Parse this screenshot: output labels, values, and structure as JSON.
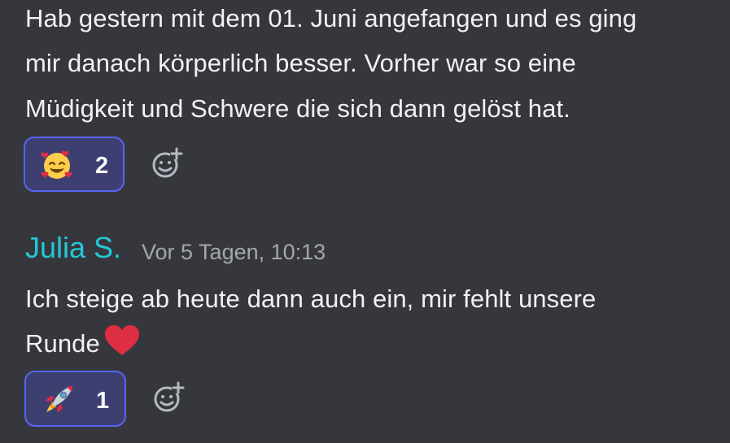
{
  "messages": [
    {
      "lines": [
        "Hab gestern mit dem 01. Juni angefangen und es ging",
        "mir danach körperlich besser. Vorher war so eine",
        "Müdigkeit und Schwere die sich dann gelöst hat."
      ],
      "reaction": {
        "emoji": "smiling-face-with-hearts",
        "count": "2"
      }
    },
    {
      "author": "Julia S.",
      "timestamp": "Vor 5 Tagen, 10:13",
      "lines": [
        "Ich steige ab heute dann auch ein, mir fehlt unsere",
        "Runde"
      ],
      "inline_emoji": "red-heart",
      "reaction": {
        "emoji": "rocket",
        "count": "1"
      }
    }
  ],
  "colors": {
    "background": "#36373d",
    "username": "#23c9d4",
    "reaction_border": "#5865f2",
    "reaction_background": "#3c3f6f",
    "timestamp": "#a3a6ad"
  },
  "icons": {
    "add_reaction": "add-reaction-icon"
  }
}
